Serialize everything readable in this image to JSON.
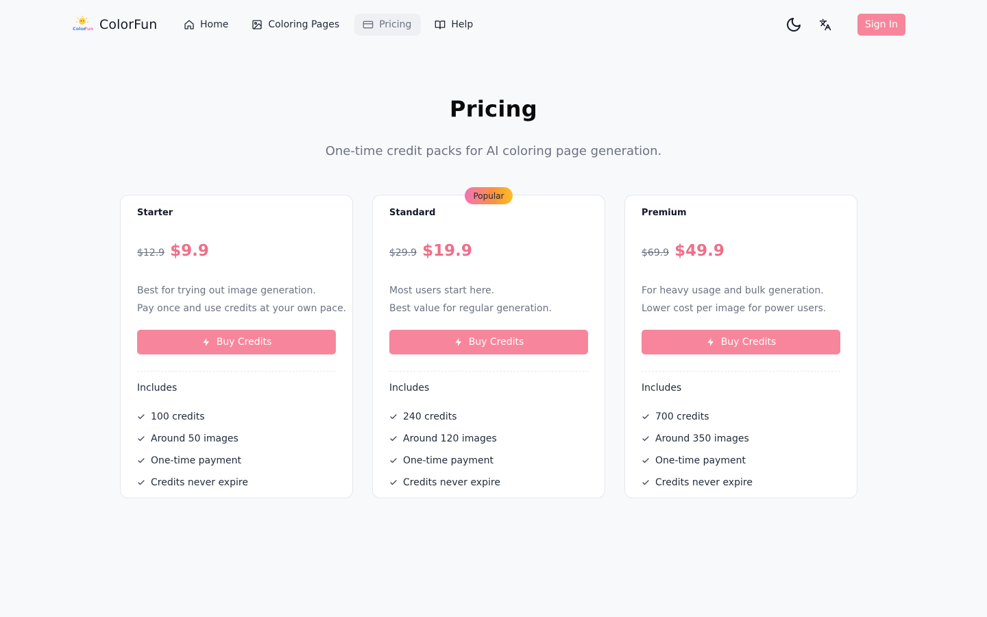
{
  "header": {
    "brand": "ColorFun",
    "logo_text": "ColorFun",
    "nav": [
      {
        "label": "Home",
        "icon": "home-icon",
        "active": false
      },
      {
        "label": "Coloring Pages",
        "icon": "image-icon",
        "active": false
      },
      {
        "label": "Pricing",
        "icon": "credit-card-icon",
        "active": true
      },
      {
        "label": "Help",
        "icon": "book-open-icon",
        "active": false
      }
    ],
    "theme_icon": "moon-icon",
    "language_icon": "translate-icon",
    "sign_in_label": "Sign In"
  },
  "hero": {
    "title": "Pricing",
    "subtitle": "One-time credit packs for AI coloring page generation."
  },
  "plans": [
    {
      "name": "Starter",
      "old_price": "$12.9",
      "price": "$9.9",
      "desc_line1": "Best for trying out image generation.",
      "desc_line2": "Pay once and use credits at your own pace.",
      "button_label": "Buy Credits",
      "includes_label": "Includes",
      "features": [
        "100 credits",
        "Around 50 images",
        "One-time payment",
        "Credits never expire"
      ]
    },
    {
      "name": "Standard",
      "badge": "Popular",
      "old_price": "$29.9",
      "price": "$19.9",
      "desc_line1": "Most users start here.",
      "desc_line2": "Best value for regular generation.",
      "button_label": "Buy Credits",
      "includes_label": "Includes",
      "features": [
        "240 credits",
        "Around 120 images",
        "One-time payment",
        "Credits never expire"
      ]
    },
    {
      "name": "Premium",
      "old_price": "$69.9",
      "price": "$49.9",
      "desc_line1": "For heavy usage and bulk generation.",
      "desc_line2": "Lower cost per image for power users.",
      "button_label": "Buy Credits",
      "includes_label": "Includes",
      "features": [
        "700 credits",
        "Around 350 images",
        "One-time payment",
        "Credits never expire"
      ]
    }
  ],
  "colors": {
    "accent": "#f7869c",
    "price": "#f06e8a",
    "background": "#f8f9fb"
  }
}
